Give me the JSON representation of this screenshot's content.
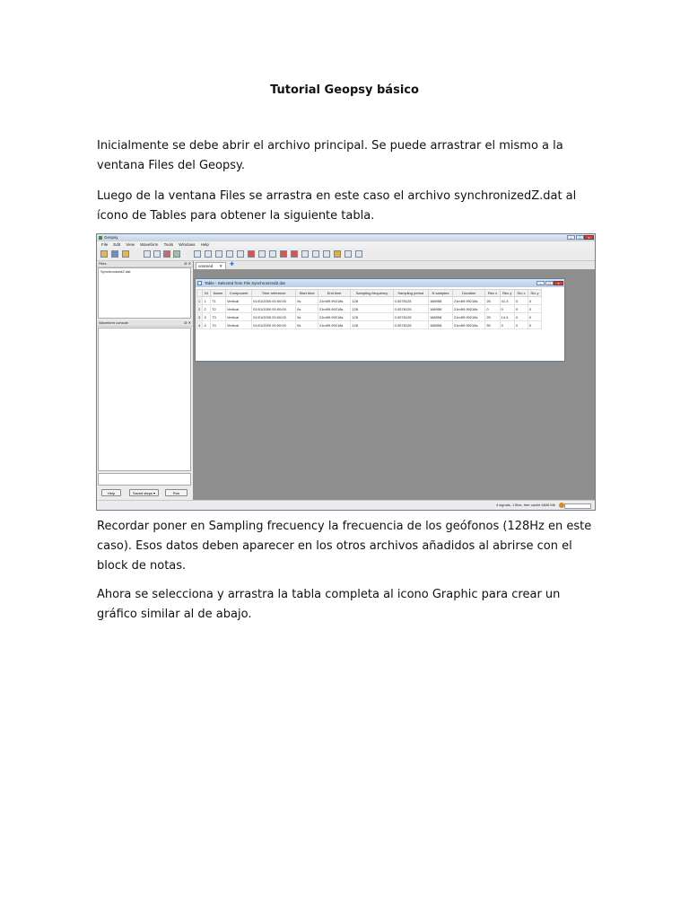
{
  "document": {
    "title": "Tutorial Geopsy básico",
    "paragraphs": [
      "Inicialmente se debe abrir el archivo principal. Se puede arrastrar el mismo a la ventana Files del Geopsy.",
      "Luego de la ventana Files se arrastra en este caso el archivo synchronizedZ.dat al ícono de Tables para obtener la siguiente tabla.",
      "Recordar poner en Sampling frecuency la frecuencia de los geófonos (128Hz en este caso). Esos datos deben aparecer en los otros archivos añadidos al abrirse con el block de notas.",
      "Ahora se selecciona y arrastra la tabla completa al icono Graphic para crear un gráfico similar al de abajo."
    ]
  },
  "app": {
    "window_title": "Geopsy",
    "menu": [
      "File",
      "Edit",
      "View",
      "Waveform",
      "Tools",
      "Windows",
      "Help"
    ],
    "files_panel": {
      "title": "Files",
      "controls": "Ø ✕",
      "item": "SynchronizedZ.dat"
    },
    "waveform_console": {
      "title": "Waveform console",
      "controls": "Ø ✕"
    },
    "buttons": {
      "help": "Help",
      "saved_steps": "Saved steps ▾",
      "run": "Run"
    },
    "tab": {
      "label": "unamed",
      "close": "✕",
      "add": "✚"
    },
    "table_window": {
      "title": "Table - Selected from File SynchronizedZ.dat",
      "columns": [
        "ID",
        "Name",
        "Component",
        "Time reference",
        "Start time",
        "End time",
        "Sampling frequency",
        "Sampling period",
        "N samples",
        "Duration",
        "Rec x",
        "Rec y",
        "Src x",
        "Src y"
      ],
      "rows": [
        [
          "1",
          "1",
          "T1",
          "Vertical",
          "01/01/2000 00:00:00",
          "0s",
          "21m59.99218s",
          "128",
          "0.0078125",
          "168958",
          "21m59.99218s",
          "25",
          "41.3",
          "0",
          "0"
        ],
        [
          "2",
          "2",
          "T2",
          "Vertical",
          "01/01/2000 00:00:00",
          "0s",
          "21m59.99218s",
          "128",
          "0.0078125",
          "168958",
          "21m59.99218s",
          "0",
          "0",
          "0",
          "0"
        ],
        [
          "3",
          "3",
          "T3",
          "Vertical",
          "01/01/2000 00:00:00",
          "0s",
          "21m59.99218s",
          "128",
          "0.0078125",
          "168958",
          "21m59.99218s",
          "25",
          "14.4",
          "0",
          "0"
        ],
        [
          "4",
          "4",
          "T4",
          "Vertical",
          "01/01/2000 00:00:00",
          "0s",
          "21m59.99218s",
          "128",
          "0.0078125",
          "168958",
          "21m59.99218s",
          "50",
          "0",
          "0",
          "0"
        ]
      ]
    },
    "status": "4 signals, 1 files, free cache 4846 Mb"
  }
}
